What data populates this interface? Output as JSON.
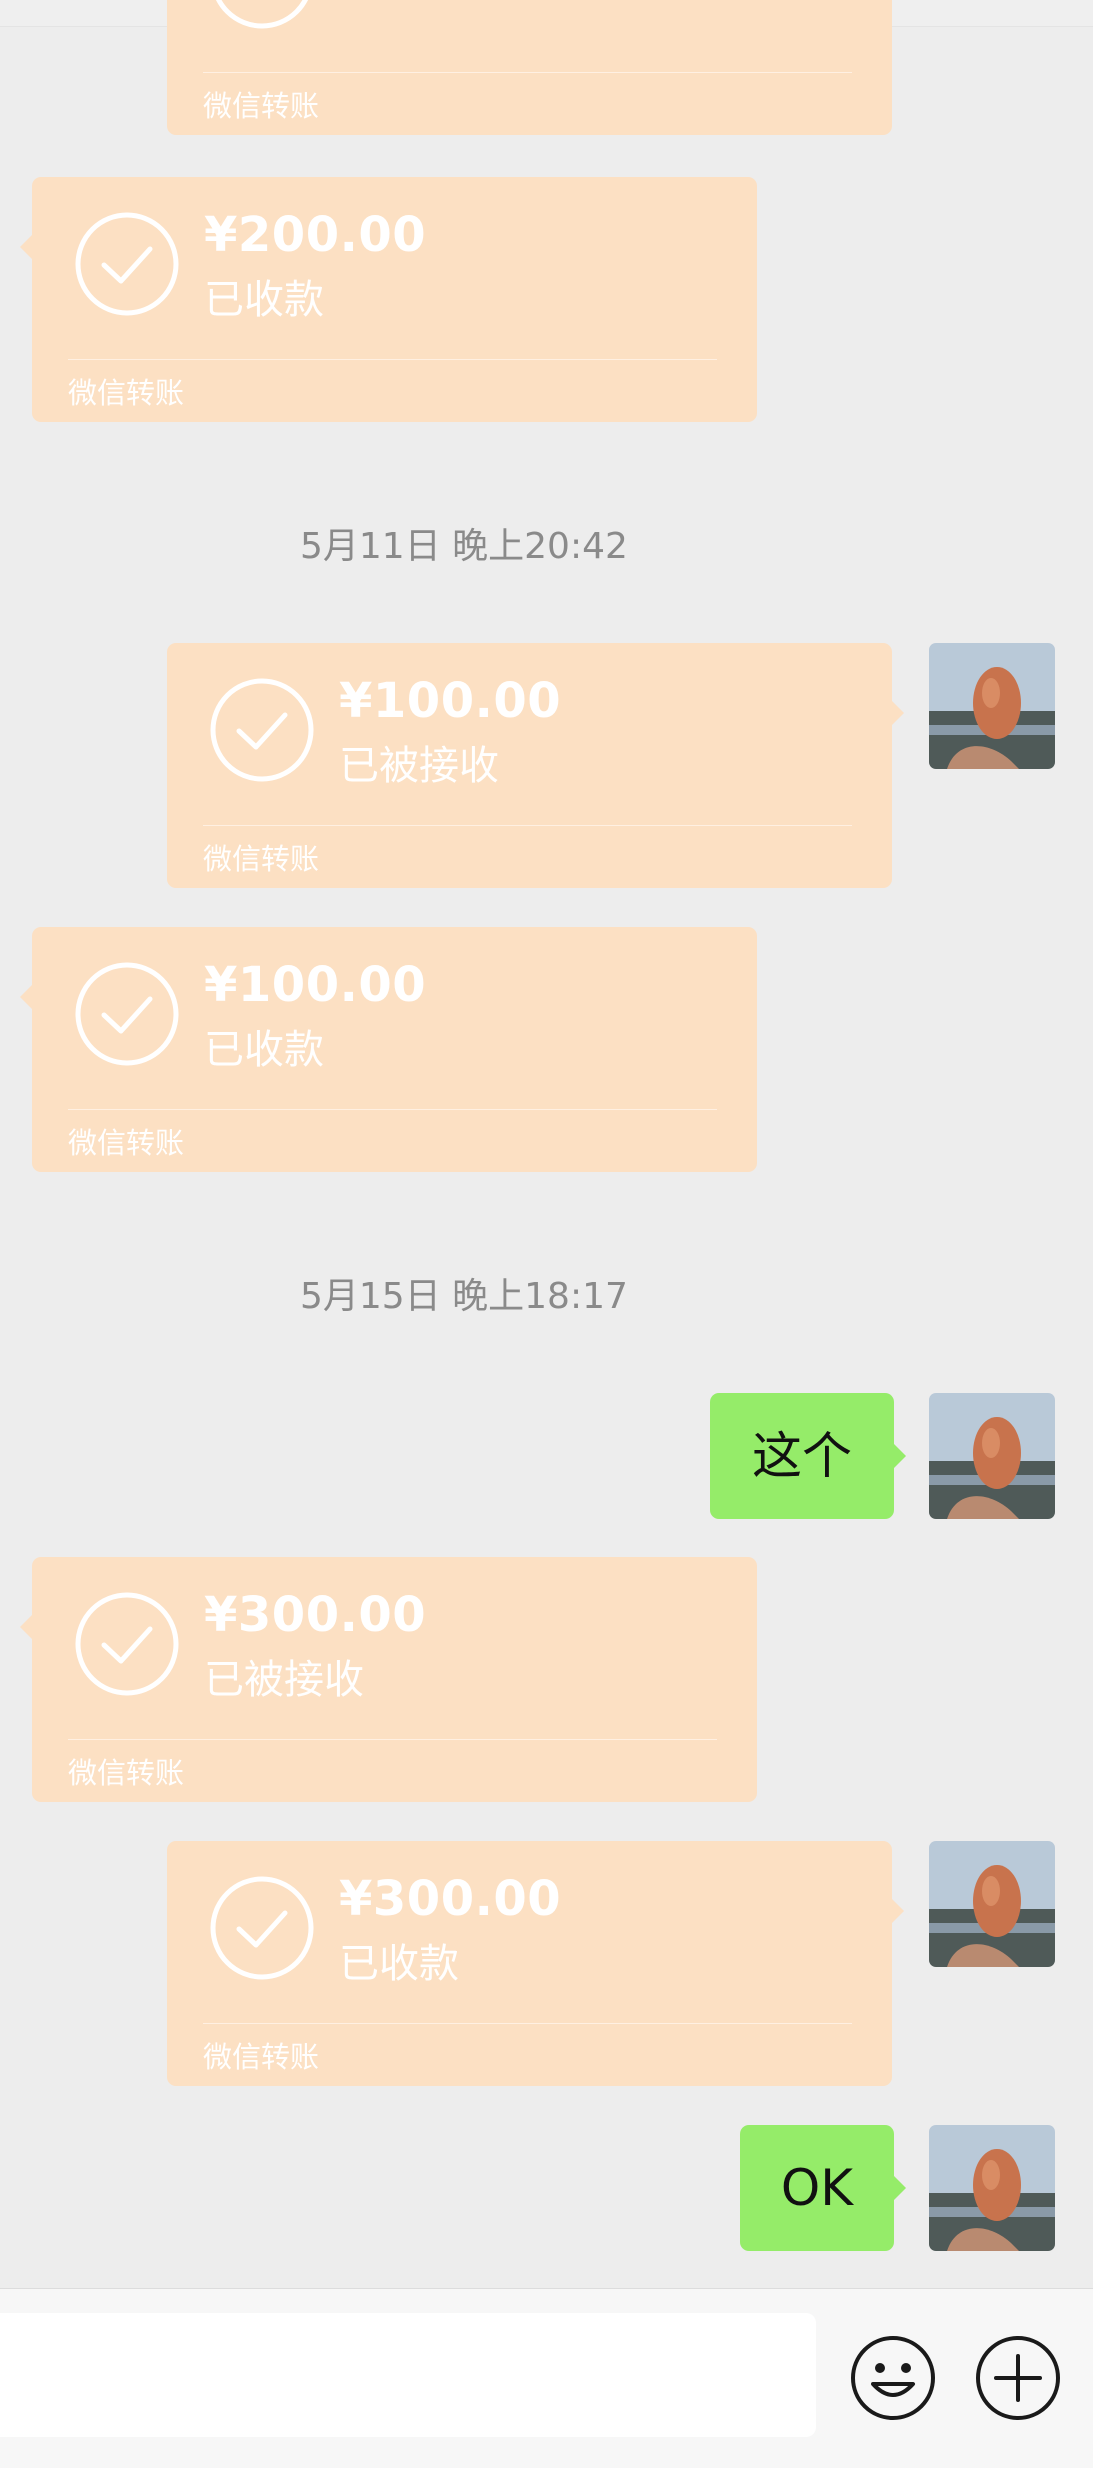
{
  "transfers": [
    {
      "amount": "",
      "status": "",
      "label": "微信转账"
    },
    {
      "amount": "¥200.00",
      "status": "已收款",
      "label": "微信转账"
    },
    {
      "amount": "¥100.00",
      "status": "已被接收",
      "label": "微信转账"
    },
    {
      "amount": "¥100.00",
      "status": "已收款",
      "label": "微信转账"
    },
    {
      "amount": "¥300.00",
      "status": "已被接收",
      "label": "微信转账"
    },
    {
      "amount": "¥300.00",
      "status": "已收款",
      "label": "微信转账"
    }
  ],
  "timestamps": [
    "5月11日 晚上20:42",
    "5月15日 晚上18:17"
  ],
  "messages": [
    {
      "text": "这个"
    },
    {
      "text": "OK"
    }
  ],
  "colors": {
    "transfer_bubble": "#fce0c3",
    "sent_bubble": "#95ec69",
    "background": "#ededed"
  },
  "icons": {
    "transfer": "check-circle-icon",
    "emoji": "smile-face-icon",
    "more": "plus-circle-icon"
  }
}
